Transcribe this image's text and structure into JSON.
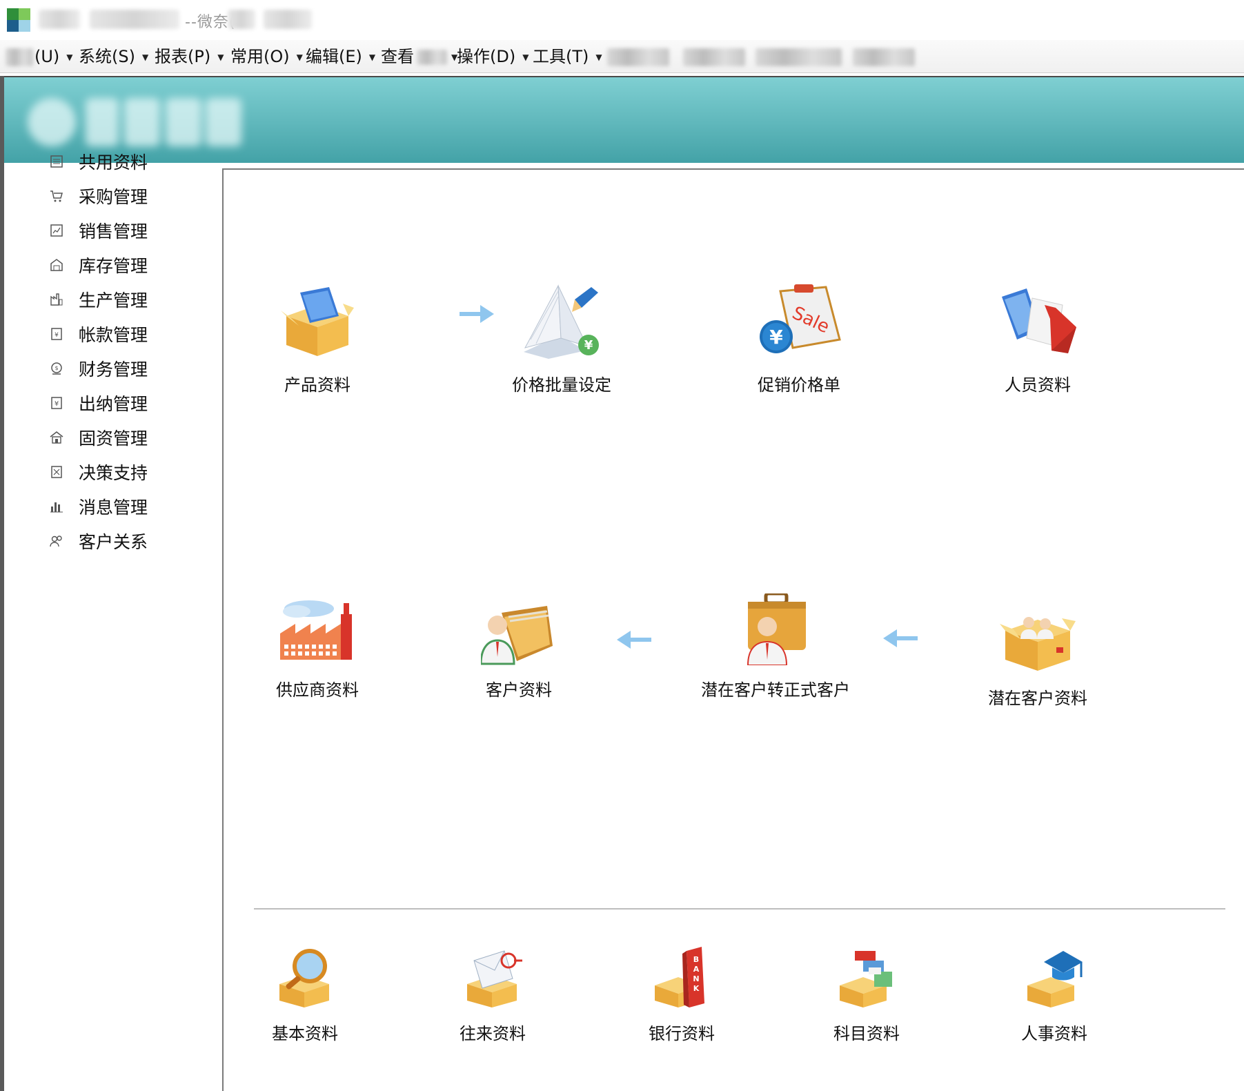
{
  "window": {
    "title_suffix": "--微奈("
  },
  "menubar": {
    "items": [
      {
        "label": "(U)"
      },
      {
        "label": "系统(S)"
      },
      {
        "label": "报表(P)"
      },
      {
        "label": "常用(O)"
      },
      {
        "label": "编辑(E)"
      },
      {
        "label": "查看"
      },
      {
        "label": "操作(D)"
      },
      {
        "label": "工具(T)"
      }
    ]
  },
  "sidebar": {
    "items": [
      {
        "label": "共用资料",
        "icon": "list-icon"
      },
      {
        "label": "采购管理",
        "icon": "cart-icon"
      },
      {
        "label": "销售管理",
        "icon": "sales-icon"
      },
      {
        "label": "库存管理",
        "icon": "warehouse-icon"
      },
      {
        "label": "生产管理",
        "icon": "factory-icon"
      },
      {
        "label": "帐款管理",
        "icon": "ledger-icon"
      },
      {
        "label": "财务管理",
        "icon": "finance-icon"
      },
      {
        "label": "出纳管理",
        "icon": "cashier-icon"
      },
      {
        "label": "固资管理",
        "icon": "asset-icon"
      },
      {
        "label": "决策支持",
        "icon": "decision-icon"
      },
      {
        "label": "消息管理",
        "icon": "chart-bars-icon"
      },
      {
        "label": "客户关系",
        "icon": "people-icon"
      }
    ]
  },
  "flow": {
    "row1": [
      {
        "label": "产品资料",
        "icon": "product-box-icon"
      },
      {
        "label": "价格批量设定",
        "icon": "price-book-icon"
      },
      {
        "label": "促销价格单",
        "icon": "sale-clipboard-icon"
      },
      {
        "label": "人员资料",
        "icon": "staff-icon"
      }
    ],
    "row2": [
      {
        "label": "供应商资料",
        "icon": "supplier-factory-icon"
      },
      {
        "label": "客户资料",
        "icon": "customer-folder-icon"
      },
      {
        "label": "潜在客户转正式客户",
        "icon": "briefcase-person-icon"
      },
      {
        "label": "潜在客户资料",
        "icon": "prospect-box-icon"
      }
    ],
    "row3": [
      {
        "label": "基本资料",
        "icon": "magnifier-box-icon"
      },
      {
        "label": "往来资料",
        "icon": "mail-box-icon"
      },
      {
        "label": "银行资料",
        "icon": "bank-box-icon"
      },
      {
        "label": "科目资料",
        "icon": "books-box-icon"
      },
      {
        "label": "人事资料",
        "icon": "graduate-box-icon"
      }
    ]
  },
  "colors": {
    "banner_top": "#7fcfd2",
    "banner_bottom": "#43a2a7",
    "arrow": "#8fc6ee",
    "box": "#f0c25a"
  }
}
